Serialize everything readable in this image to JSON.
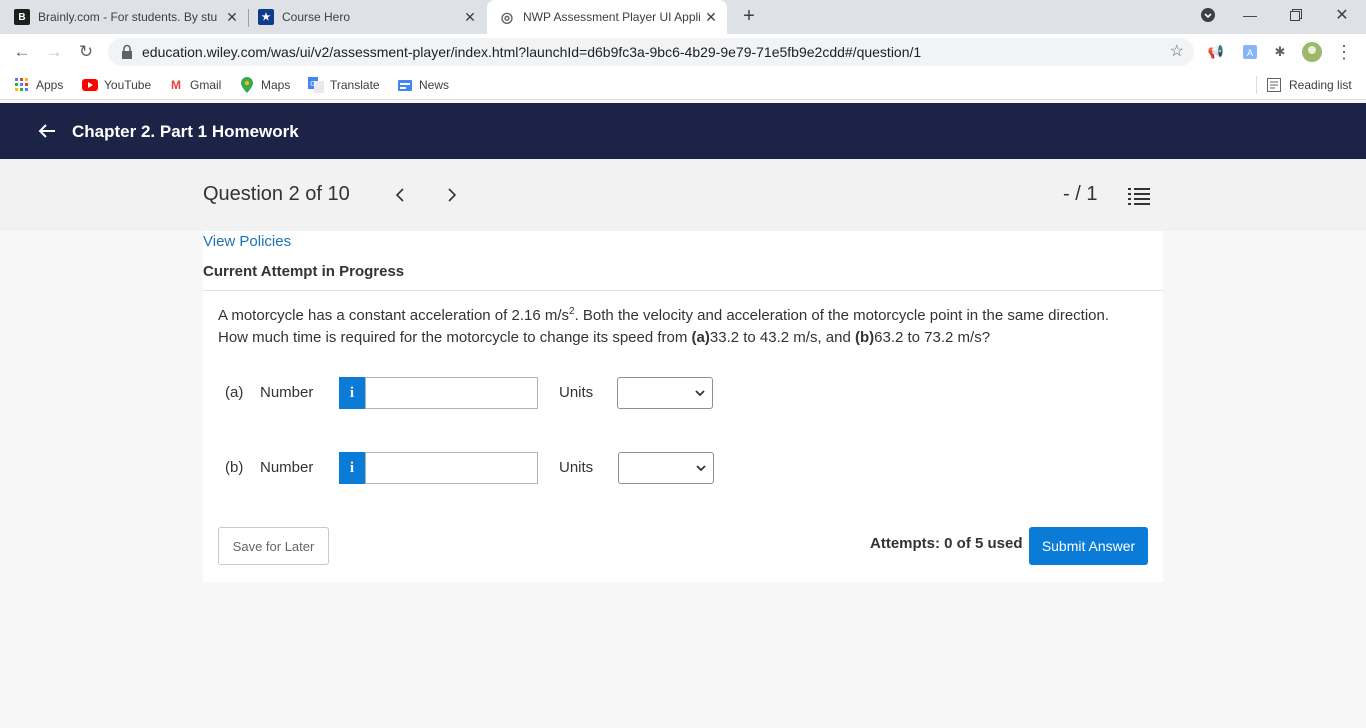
{
  "browser": {
    "tabs": [
      {
        "title": "Brainly.com - For students. By stu",
        "favicon": "B"
      },
      {
        "title": "Course Hero",
        "favicon": "★"
      },
      {
        "title": "NWP Assessment Player UI Appli",
        "favicon": "◎"
      }
    ],
    "url": "education.wiley.com/was/ui/v2/assessment-player/index.html?launchId=d6b9fc3a-9bc6-4b29-9e79-71e5fb9e2cdd#/question/1",
    "bookmarks": [
      "Apps",
      "YouTube",
      "Gmail",
      "Maps",
      "Translate",
      "News"
    ],
    "reading_list": "Reading list"
  },
  "header": {
    "title": "Chapter 2. Part 1 Homework"
  },
  "question_nav": {
    "label": "Question 2 of 10",
    "score": "- / 1"
  },
  "content": {
    "view_policies": "View Policies",
    "attempt_status": "Current Attempt in Progress",
    "question_pre": "A motorcycle has a constant acceleration of 2.16 m/s",
    "question_sup": "2",
    "question_mid": ". Both the velocity and acceleration of the motorcycle point in the same direction. How much time is required for the motorcycle to change its speed from ",
    "part_a_bold": "(a)",
    "part_a_range": "33.2 to 43.2 m/s, and ",
    "part_b_bold": "(b)",
    "part_b_range": "63.2 to 73.2 m/s?",
    "rows": [
      {
        "part": "(a)",
        "number_label": "Number",
        "info": "i",
        "value": "",
        "units_label": "Units",
        "unit_selected": ""
      },
      {
        "part": "(b)",
        "number_label": "Number",
        "info": "i",
        "value": "",
        "units_label": "Units",
        "unit_selected": ""
      }
    ],
    "save_label": "Save for Later",
    "attempts": "Attempts: 0 of 5 used",
    "submit_label": "Submit Answer"
  },
  "colors": {
    "header_bg": "#1b2346",
    "accent": "#0a7bd6",
    "link": "#1a73b8"
  }
}
